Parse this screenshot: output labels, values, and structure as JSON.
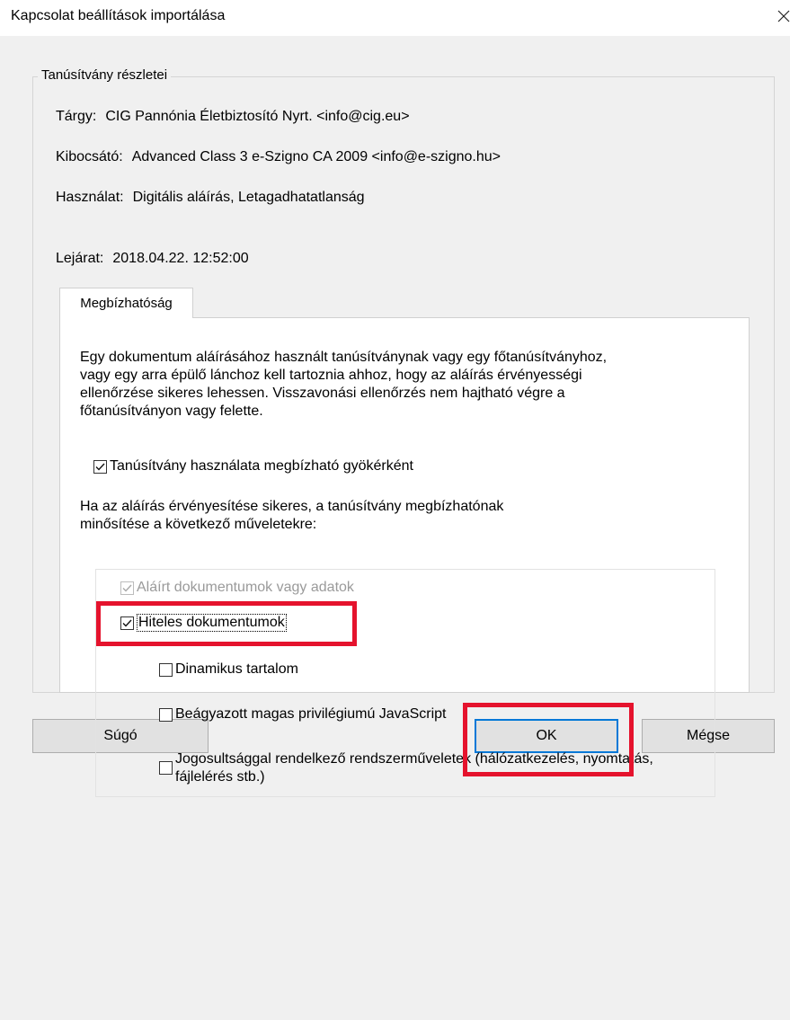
{
  "dialog": {
    "title": "Kapcsolat beállítások importálása"
  },
  "group": {
    "legend": "Tanúsítvány részletei"
  },
  "details": {
    "subject_label": "Tárgy:",
    "subject_value": "CIG Pannónia Életbiztosító Nyrt. <info@cig.eu>",
    "issuer_label": "Kibocsátó:",
    "issuer_value": "Advanced Class 3 e-Szigno CA 2009 <info@e-szigno.hu>",
    "usage_label": "Használat:",
    "usage_value": "Digitális aláírás, Letagadhatatlanság",
    "expiry_label": "Lejárat:",
    "expiry_value": "2018.04.22. 12:52:00"
  },
  "tab": {
    "label": "Megbízhatóság"
  },
  "trust": {
    "description_lines": [
      "Egy dokumentum aláírásához használt tanúsítványnak vagy egy főtanúsítványhoz,",
      "vagy egy arra épülő lánchoz kell tartoznia ahhoz, hogy az aláírás érvényességi",
      "ellenőrzése sikeres lehessen. Visszavonási ellenőrzés nem hajtható végre a",
      "főtanúsítványon vagy felette."
    ],
    "root_checkbox_label": "Tanúsítvány használata megbízható gyökérként",
    "root_checked": true,
    "qualify_lines": [
      "Ha az aláírás érvényesítése sikeres, a tanúsítvány megbízhatónak",
      "minősítése a következő műveletekre:"
    ],
    "options": {
      "signed_docs_label": "Aláírt dokumentumok vagy adatok",
      "signed_docs_checked": true,
      "signed_docs_disabled": true,
      "certified_docs_label": "Hiteles dokumentumok",
      "certified_docs_checked": true,
      "dynamic_content_label": "Dinamikus tartalom",
      "dynamic_content_checked": false,
      "embedded_js_label": "Beágyazott magas privilégiumú JavaScript",
      "embedded_js_checked": false,
      "privileged_ops_label": "Jogosultsággal rendelkező rendszerműveletek (hálózatkezelés, nyomtatás, fájlelérés stb.)",
      "privileged_ops_checked": false
    }
  },
  "buttons": {
    "help": "Súgó",
    "ok": "OK",
    "cancel": "Mégse"
  },
  "colors": {
    "highlight": "#e5132d",
    "default_button_border": "#0078d7",
    "dialog_background": "#f0f0f0"
  },
  "icons": [
    "close-icon",
    "checkmark-icon"
  ]
}
